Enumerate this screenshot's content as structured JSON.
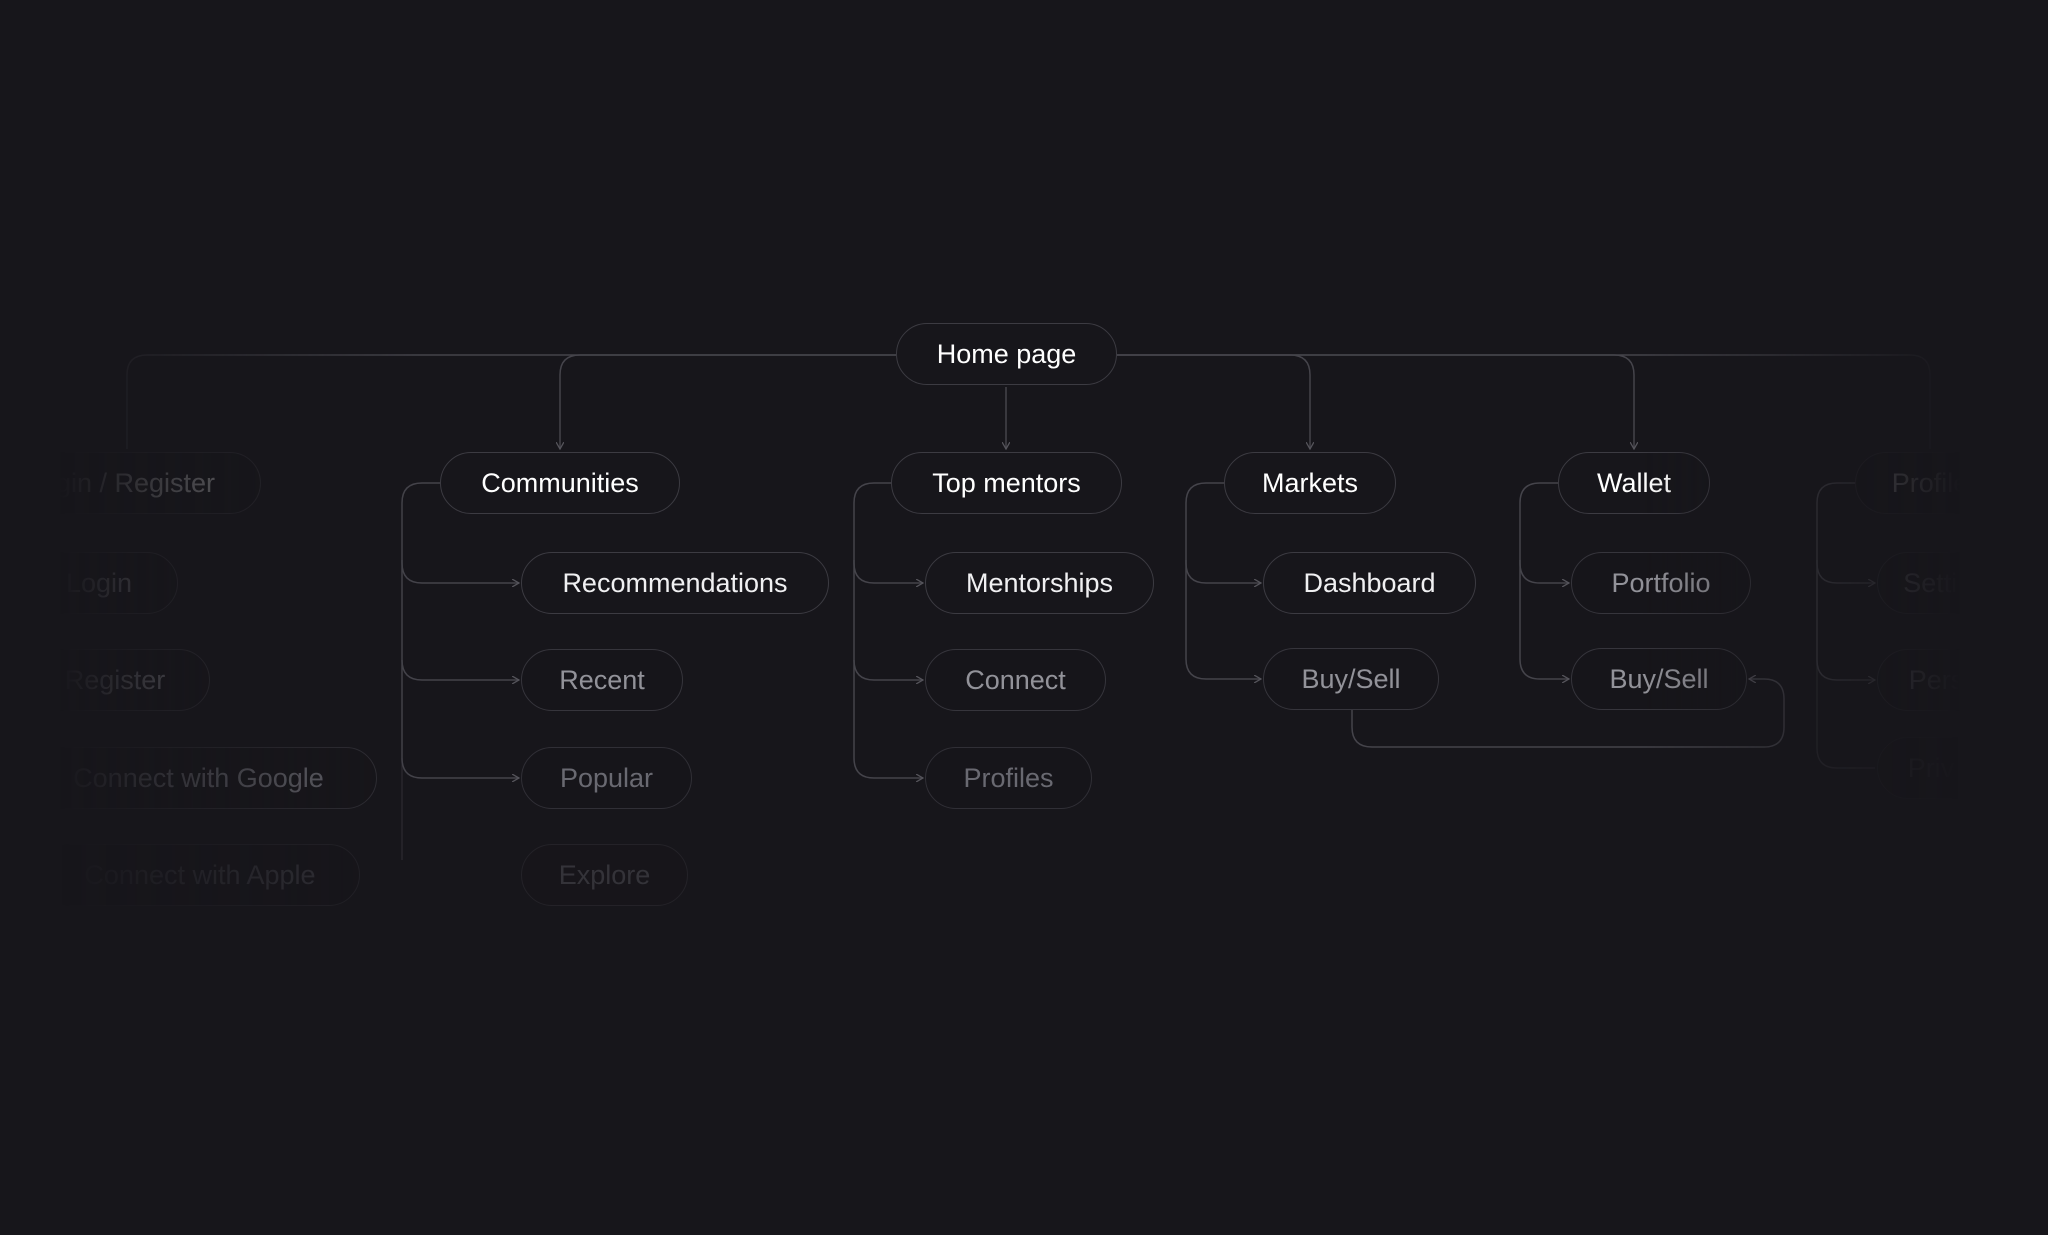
{
  "root": {
    "label": "Home page"
  },
  "branches": [
    {
      "label": "Login / Register",
      "children": [
        "Login",
        "Register",
        "Connect with Google",
        "Connect with Apple"
      ]
    },
    {
      "label": "Communities",
      "children": [
        "Recommendations",
        "Recent",
        "Popular",
        "Explore"
      ]
    },
    {
      "label": "Top mentors",
      "children": [
        "Mentorships",
        "Connect",
        "Profiles"
      ]
    },
    {
      "label": "Markets",
      "children": [
        "Dashboard",
        "Buy/Sell"
      ]
    },
    {
      "label": "Wallet",
      "children": [
        "Portfolio",
        "Buy/Sell"
      ]
    },
    {
      "label": "Profile",
      "children": [
        "Settings",
        "Personal",
        "Privacy"
      ]
    }
  ],
  "colors": {
    "background": "#17161b",
    "border": "#3c3b42",
    "text": "#ffffff"
  }
}
